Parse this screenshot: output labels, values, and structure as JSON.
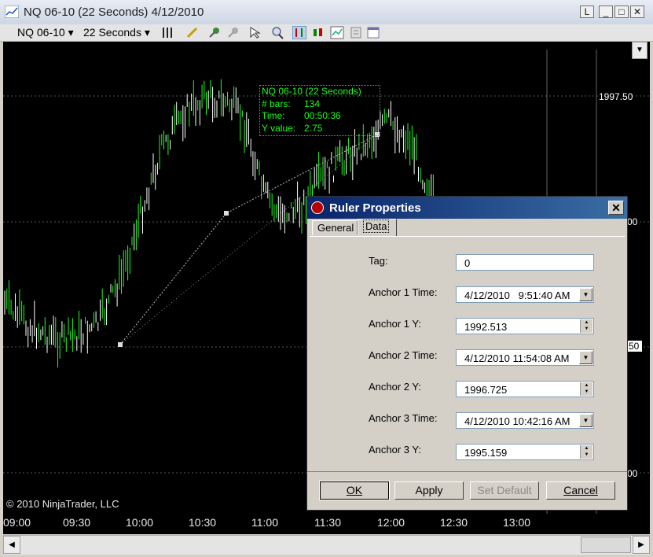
{
  "window": {
    "title": "NQ 06-10 (22 Seconds)  4/12/2010",
    "controls": [
      "L",
      "_",
      "□",
      "✕"
    ]
  },
  "toolbar": {
    "instrument": "NQ 06-10",
    "interval": "22 Seconds"
  },
  "chart": {
    "price_labels": [
      "1997.50",
      "00",
      "50",
      "00"
    ],
    "copyright": "© 2010 NinjaTrader, LLC",
    "time_labels": [
      "09:00",
      "09:30",
      "10:00",
      "10:30",
      "11:00",
      "11:30",
      "12:00",
      "12:30",
      "13:00"
    ],
    "info": {
      "title": "NQ 06-10 (22 Seconds)",
      "rows": [
        {
          "label": "# bars:",
          "value": "134"
        },
        {
          "label": "Time:",
          "value": "00:50:36"
        },
        {
          "label": "Y value:",
          "value": "2.75"
        }
      ]
    },
    "bar_color": "#19ff19",
    "background": "#000000"
  },
  "dialog": {
    "title": "Ruler Properties",
    "tabs": [
      "General",
      "Data"
    ],
    "active_tab": "Data",
    "fields": [
      {
        "label": "Tag:",
        "value": "0",
        "kind": "text"
      },
      {
        "label": "Anchor 1 Time:",
        "value": "4/12/2010   9:51:40 AM",
        "kind": "dropdown"
      },
      {
        "label": "Anchor 1 Y:",
        "value": "1992.513",
        "kind": "spin"
      },
      {
        "label": "Anchor 2 Time:",
        "value": "4/12/2010 11:54:08 AM",
        "kind": "dropdown"
      },
      {
        "label": "Anchor 2 Y:",
        "value": "1996.725",
        "kind": "spin"
      },
      {
        "label": "Anchor 3 Time:",
        "value": "4/12/2010 10:42:16 AM",
        "kind": "dropdown"
      },
      {
        "label": "Anchor 3 Y:",
        "value": "1995.159",
        "kind": "spin"
      }
    ],
    "buttons": {
      "ok": "OK",
      "apply": "Apply",
      "set_default": "Set Default",
      "cancel": "Cancel"
    }
  }
}
